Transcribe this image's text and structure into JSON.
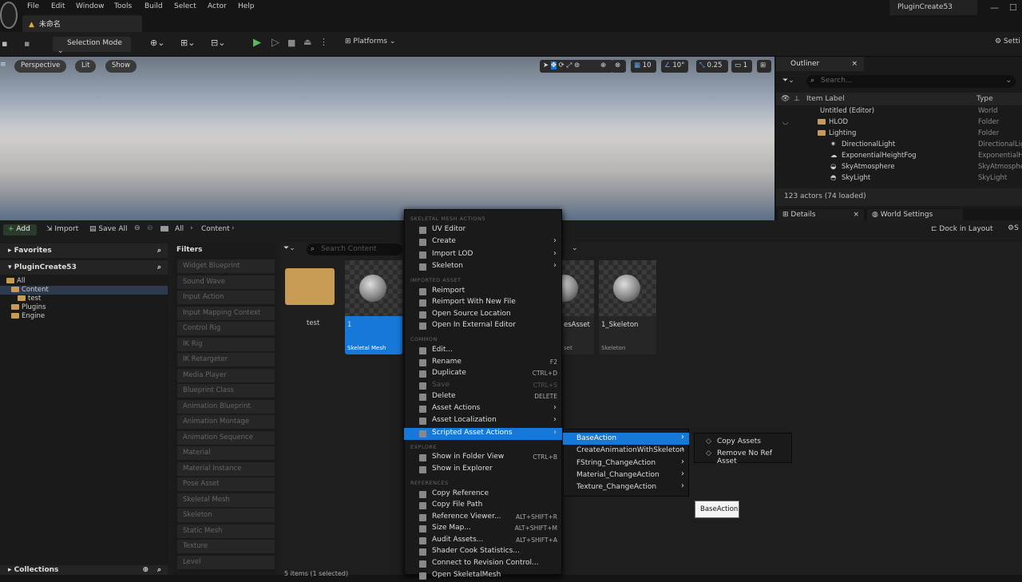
{
  "menubar": {
    "items": [
      "File",
      "Edit",
      "Window",
      "Tools",
      "Build",
      "Select",
      "Actor",
      "Help"
    ],
    "document_tab": "未命名",
    "project_tab": "PluginCreate53"
  },
  "toolbar": {
    "selection_mode": "Selection Mode",
    "platforms": "Platforms",
    "settings": "Setti"
  },
  "viewport": {
    "perspective": "Perspective",
    "lit": "Lit",
    "show": "Show",
    "grid_value": "10",
    "angle_value": "10°",
    "scale_value": "0.25",
    "camera_value": "1"
  },
  "outliner": {
    "tab": "Outliner",
    "search_placeholder": "Search...",
    "col_label": "Item Label",
    "col_type": "Type",
    "rows": [
      {
        "label": "Untitled (Editor)",
        "type": "World"
      },
      {
        "label": "HLOD",
        "type": "Folder"
      },
      {
        "label": "Lighting",
        "type": "Folder"
      },
      {
        "label": "DirectionalLight",
        "type": "DirectionalLig"
      },
      {
        "label": "ExponentialHeightFog",
        "type": "ExponentialHe"
      },
      {
        "label": "SkyAtmosphere",
        "type": "SkyAtmosphe"
      },
      {
        "label": "SkyLight",
        "type": "SkyLight"
      }
    ],
    "status": "123 actors (74 loaded)",
    "details_tab": "Details",
    "world_settings_tab": "World Settings"
  },
  "content_browser": {
    "add": "Add",
    "import": "Import",
    "save_all": "Save All",
    "path": [
      "All",
      "Content"
    ],
    "dock": "Dock in Layout",
    "favorites": "Favorites",
    "project": "PluginCreate53",
    "tree": [
      "All",
      "Content",
      "test",
      "Plugins",
      "Engine"
    ],
    "collections": "Collections",
    "filters_title": "Filters",
    "filters": [
      "Widget Blueprint",
      "Sound Wave",
      "Input Action",
      "Input Mapping Context",
      "Control Rig",
      "IK Rig",
      "IK Retargeter",
      "Media Player",
      "Blueprint Class",
      "Animation Blueprint",
      "Animation Montage",
      "Animation Sequence",
      "Material",
      "Material Instance",
      "Pose Asset",
      "Skeletal Mesh",
      "Skeleton",
      "Static Mesh",
      "Texture",
      "Level"
    ],
    "search_placeholder": "Search Content",
    "tiles": [
      {
        "label": "test",
        "type": ""
      },
      {
        "label": "1",
        "type": "Skeletal Mesh"
      },
      {
        "label": "esAsset",
        "type": "set"
      },
      {
        "label": "1_Skeleton",
        "type": "Skeleton"
      }
    ],
    "status": "5 items (1 selected)"
  },
  "context_menu": {
    "sections": {
      "skeletal": "SKELETAL MESH ACTIONS",
      "imported": "IMPORTED ASSET",
      "common": "COMMON",
      "explore": "EXPLORE",
      "references": "REFERENCES"
    },
    "items": [
      {
        "label": "UV Editor",
        "shortcut": "",
        "arrow": ""
      },
      {
        "label": "Create",
        "shortcut": "",
        "arrow": "›"
      },
      {
        "label": "Import LOD",
        "shortcut": "",
        "arrow": "›"
      },
      {
        "label": "Skeleton",
        "shortcut": "",
        "arrow": "›"
      },
      {
        "label": "Reimport",
        "shortcut": "",
        "arrow": ""
      },
      {
        "label": "Reimport With New File",
        "shortcut": "",
        "arrow": ""
      },
      {
        "label": "Open Source Location",
        "shortcut": "",
        "arrow": ""
      },
      {
        "label": "Open In External Editor",
        "shortcut": "",
        "arrow": ""
      },
      {
        "label": "Edit...",
        "shortcut": "",
        "arrow": ""
      },
      {
        "label": "Rename",
        "shortcut": "F2",
        "arrow": ""
      },
      {
        "label": "Duplicate",
        "shortcut": "CTRL+D",
        "arrow": ""
      },
      {
        "label": "Save",
        "shortcut": "CTRL+S",
        "arrow": ""
      },
      {
        "label": "Delete",
        "shortcut": "DELETE",
        "arrow": ""
      },
      {
        "label": "Asset Actions",
        "shortcut": "",
        "arrow": "›"
      },
      {
        "label": "Asset Localization",
        "shortcut": "",
        "arrow": "›"
      },
      {
        "label": "Scripted Asset Actions",
        "shortcut": "",
        "arrow": "›"
      },
      {
        "label": "Show in Folder View",
        "shortcut": "CTRL+B",
        "arrow": ""
      },
      {
        "label": "Show in Explorer",
        "shortcut": "",
        "arrow": ""
      },
      {
        "label": "Copy Reference",
        "shortcut": "",
        "arrow": ""
      },
      {
        "label": "Copy File Path",
        "shortcut": "",
        "arrow": ""
      },
      {
        "label": "Reference Viewer...",
        "shortcut": "ALT+SHIFT+R",
        "arrow": ""
      },
      {
        "label": "Size Map...",
        "shortcut": "ALT+SHIFT+M",
        "arrow": ""
      },
      {
        "label": "Audit Assets...",
        "shortcut": "ALT+SHIFT+A",
        "arrow": ""
      },
      {
        "label": "Shader Cook Statistics...",
        "shortcut": "",
        "arrow": ""
      },
      {
        "label": "Connect to Revision Control...",
        "shortcut": "",
        "arrow": ""
      },
      {
        "label": "Open SkeletalMesh",
        "shortcut": "",
        "arrow": ""
      }
    ]
  },
  "submenu": {
    "items": [
      "BaseAction",
      "CreateAnimationWithSkeleton",
      "FString_ChangeAction",
      "Material_ChangeAction",
      "Texture_ChangeAction"
    ]
  },
  "submenu2": {
    "items": [
      "Copy Assets",
      "Remove No Ref Asset"
    ]
  },
  "tooltip": "BaseAction",
  "colors": {
    "highlight": "#1679d9",
    "folder": "#c69c54"
  }
}
